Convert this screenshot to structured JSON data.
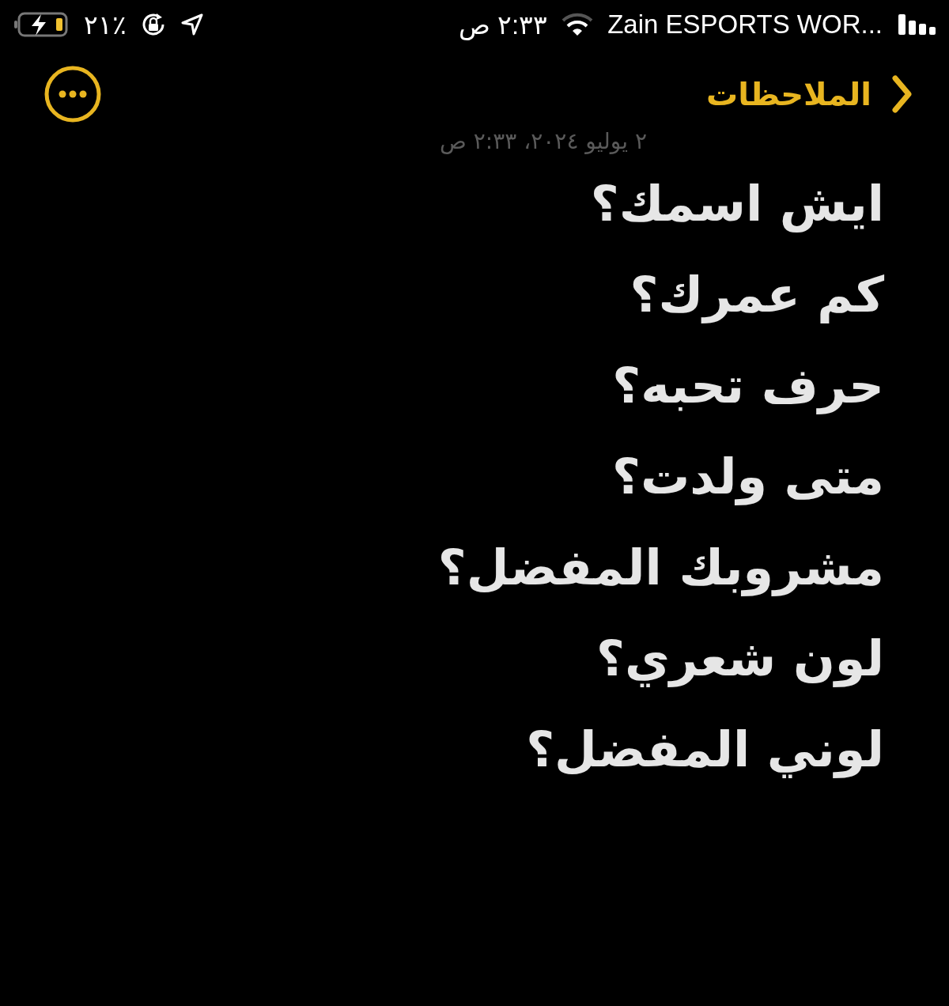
{
  "status_bar": {
    "carrier": "Zain ESPORTS WOR...",
    "time": "٢:٣٣ ص",
    "battery_percent": "٢١٪"
  },
  "nav": {
    "back_label": "الملاحظات"
  },
  "note": {
    "date": "٢ يوليو ٢٠٢٤، ٢:٣٣ ص",
    "lines": [
      "ايش اسمك؟",
      "كم عمرك؟",
      "حرف تحبه؟",
      "متى ولدت؟",
      "مشروبك المفضل؟",
      "لون شعري؟",
      "لوني المفضل؟"
    ]
  }
}
